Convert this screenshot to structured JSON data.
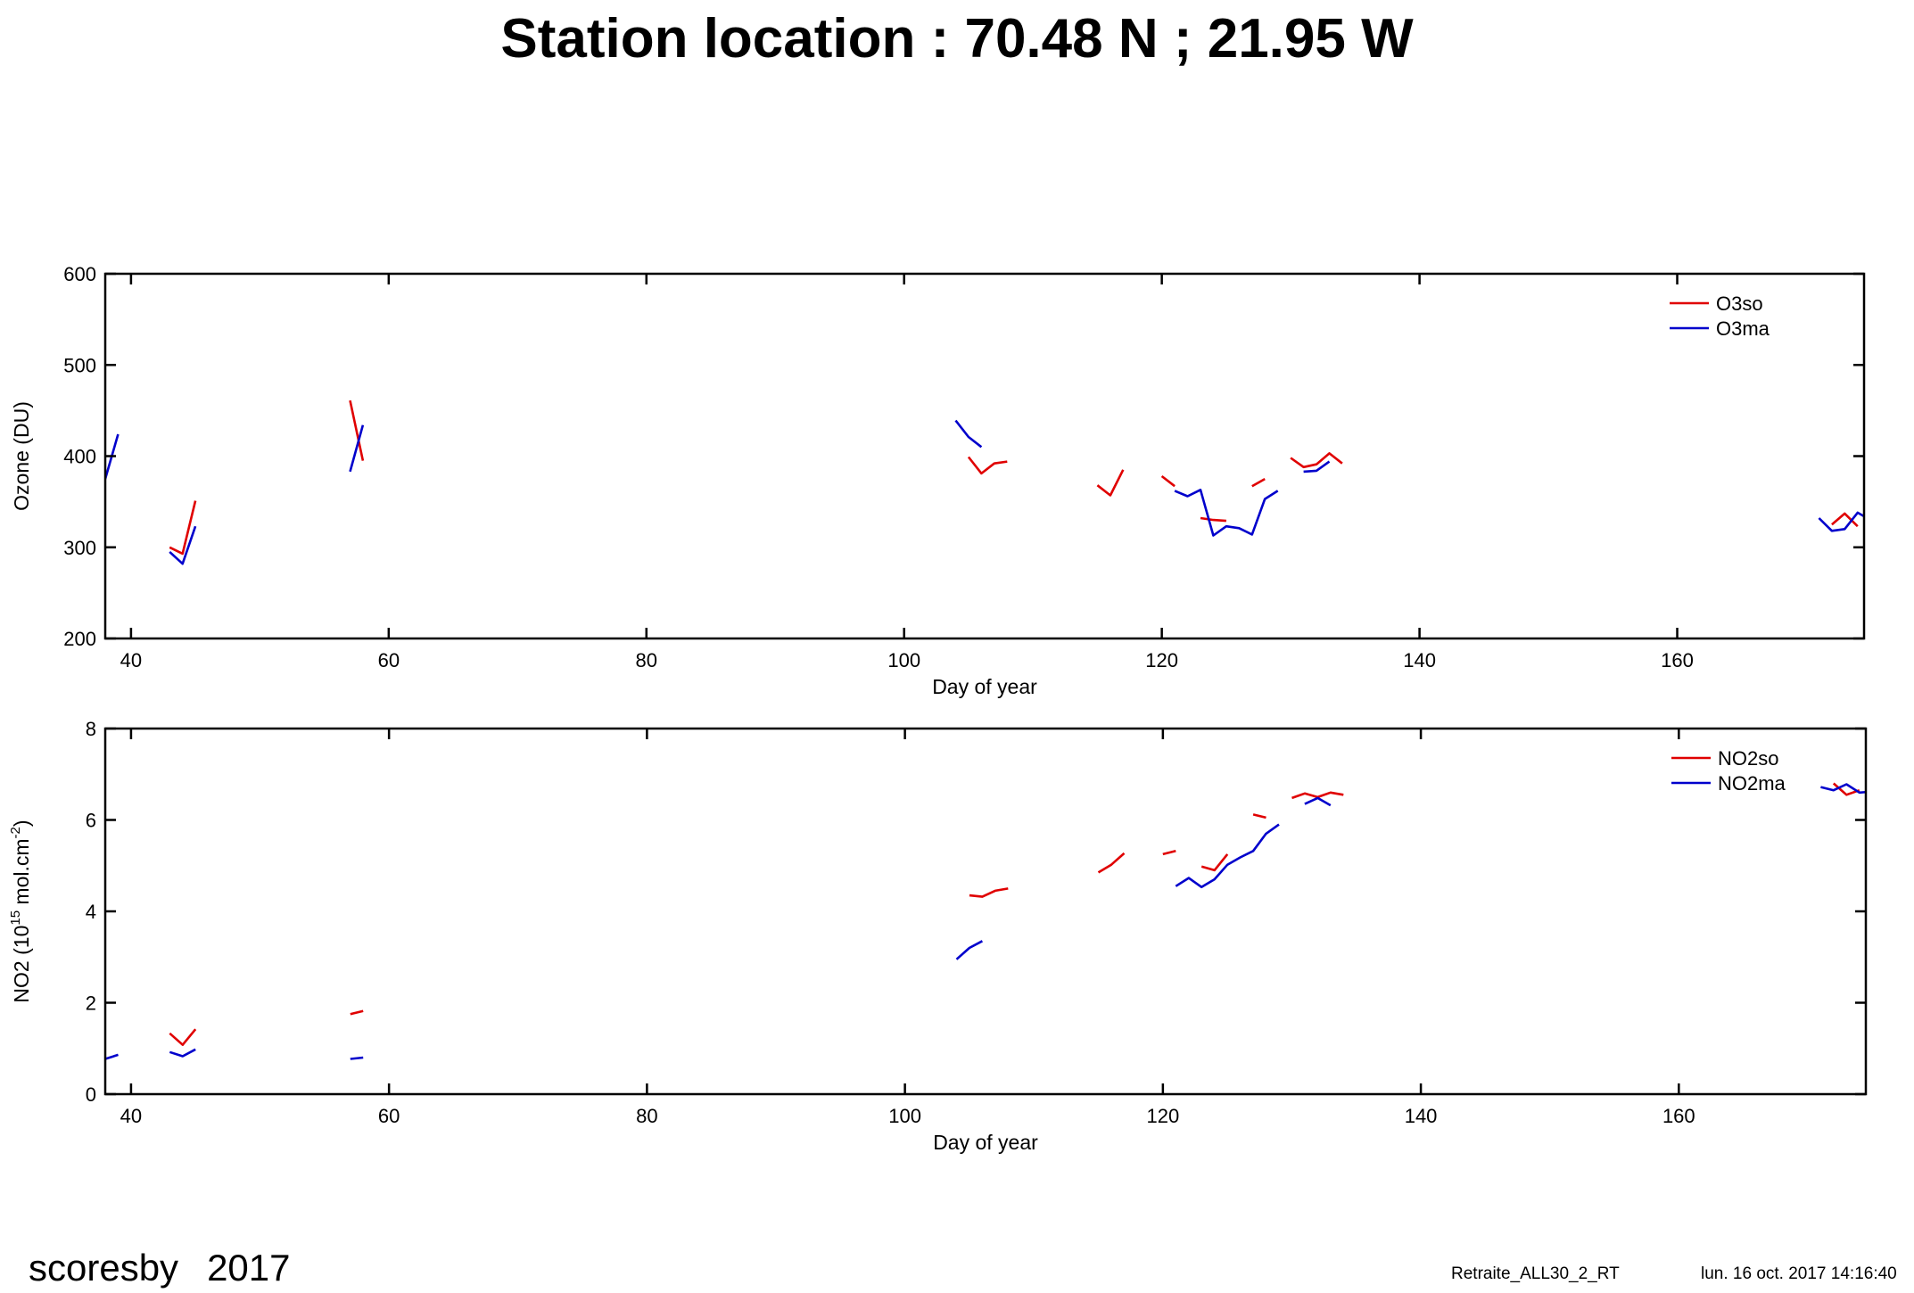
{
  "title": "Station location : 70.48 N ; 21.95 W",
  "footer": {
    "station": "scoresby",
    "year": "2017",
    "run": "Retraite_ALL30_2_RT",
    "timestamp": "lun. 16 oct. 2017 14:16:40"
  },
  "colors": {
    "so": "#e00000",
    "ma": "#0000cc"
  },
  "chart_data": [
    {
      "type": "line",
      "xlabel": "Day of year",
      "ylabel": "Ozone (DU)",
      "xlim": [
        38,
        174.5
      ],
      "ylim": [
        200,
        600
      ],
      "xticks": [
        40,
        60,
        80,
        100,
        120,
        140,
        160
      ],
      "yticks": [
        200,
        300,
        400,
        500,
        600
      ],
      "legend_position": "top-right",
      "grid": false,
      "series": [
        {
          "name": "O3so",
          "color": "#e00000",
          "segments": [
            [
              [
                43,
                300
              ],
              [
                44,
                293
              ],
              [
                45,
                351
              ]
            ],
            [
              [
                57,
                461
              ],
              [
                58,
                395
              ]
            ],
            [
              [
                105,
                399
              ],
              [
                106,
                381
              ],
              [
                107,
                392
              ],
              [
                108,
                394
              ]
            ],
            [
              [
                115,
                368
              ],
              [
                116,
                357
              ],
              [
                117,
                385
              ]
            ],
            [
              [
                120,
                378
              ],
              [
                121,
                367
              ]
            ],
            [
              [
                123,
                332
              ],
              [
                124,
                330
              ],
              [
                125,
                329
              ]
            ],
            [
              [
                127,
                367
              ],
              [
                128,
                375
              ]
            ],
            [
              [
                130,
                398
              ],
              [
                131,
                388
              ],
              [
                132,
                391
              ],
              [
                133,
                403
              ],
              [
                134,
                392
              ]
            ],
            [
              [
                172,
                325
              ],
              [
                173,
                337
              ],
              [
                174,
                323
              ]
            ]
          ]
        },
        {
          "name": "O3ma",
          "color": "#0000cc",
          "segments": [
            [
              [
                38,
                375
              ],
              [
                39,
                424
              ]
            ],
            [
              [
                43,
                295
              ],
              [
                44,
                282
              ],
              [
                45,
                323
              ]
            ],
            [
              [
                57,
                383
              ],
              [
                58,
                434
              ]
            ],
            [
              [
                104,
                439
              ],
              [
                105,
                421
              ],
              [
                106,
                410
              ]
            ],
            [
              [
                121,
                362
              ],
              [
                122,
                356
              ],
              [
                123,
                363
              ],
              [
                124,
                313
              ],
              [
                125,
                323
              ],
              [
                126,
                321
              ],
              [
                127,
                314
              ],
              [
                128,
                353
              ],
              [
                129,
                362
              ]
            ],
            [
              [
                131,
                383
              ],
              [
                132,
                384
              ],
              [
                133,
                394
              ]
            ],
            [
              [
                171,
                332
              ],
              [
                172,
                318
              ],
              [
                173,
                320
              ],
              [
                174,
                338
              ],
              [
                175,
                330
              ]
            ]
          ]
        }
      ]
    },
    {
      "type": "line",
      "xlabel": "Day of year",
      "ylabel": "NO2 (10^15 mol.cm^-2)",
      "xlim": [
        38,
        174.5
      ],
      "ylim": [
        0,
        8
      ],
      "xticks": [
        40,
        60,
        80,
        100,
        120,
        140,
        160
      ],
      "yticks": [
        0,
        2,
        4,
        6,
        8
      ],
      "legend_position": "top-right",
      "grid": false,
      "series": [
        {
          "name": "NO2so",
          "color": "#e00000",
          "segments": [
            [
              [
                43,
                1.33
              ],
              [
                44,
                1.08
              ],
              [
                45,
                1.42
              ]
            ],
            [
              [
                57,
                1.75
              ],
              [
                58,
                1.82
              ]
            ],
            [
              [
                105,
                4.35
              ],
              [
                106,
                4.32
              ],
              [
                107,
                4.45
              ],
              [
                108,
                4.5
              ]
            ],
            [
              [
                115,
                4.85
              ],
              [
                116,
                5.02
              ],
              [
                117,
                5.27
              ]
            ],
            [
              [
                120,
                5.25
              ],
              [
                121,
                5.32
              ]
            ],
            [
              [
                123,
                4.98
              ],
              [
                124,
                4.9
              ],
              [
                125,
                5.25
              ]
            ],
            [
              [
                127,
                6.12
              ],
              [
                128,
                6.05
              ]
            ],
            [
              [
                130,
                6.48
              ],
              [
                131,
                6.58
              ],
              [
                132,
                6.5
              ],
              [
                133,
                6.6
              ],
              [
                134,
                6.55
              ]
            ],
            [
              [
                172,
                6.8
              ],
              [
                173,
                6.55
              ],
              [
                174,
                6.65
              ]
            ]
          ]
        },
        {
          "name": "NO2ma",
          "color": "#0000cc",
          "segments": [
            [
              [
                38,
                0.77
              ],
              [
                39,
                0.86
              ]
            ],
            [
              [
                43,
                0.92
              ],
              [
                44,
                0.83
              ],
              [
                45,
                0.98
              ]
            ],
            [
              [
                57,
                0.77
              ],
              [
                58,
                0.8
              ]
            ],
            [
              [
                104,
                2.95
              ],
              [
                105,
                3.2
              ],
              [
                106,
                3.35
              ]
            ],
            [
              [
                121,
                4.55
              ],
              [
                122,
                4.73
              ],
              [
                123,
                4.53
              ],
              [
                124,
                4.7
              ],
              [
                125,
                5.02
              ],
              [
                126,
                5.18
              ],
              [
                127,
                5.32
              ],
              [
                128,
                5.7
              ],
              [
                129,
                5.9
              ]
            ],
            [
              [
                131,
                6.35
              ],
              [
                132,
                6.48
              ],
              [
                133,
                6.32
              ]
            ],
            [
              [
                171,
                6.72
              ],
              [
                172,
                6.65
              ],
              [
                173,
                6.78
              ],
              [
                174,
                6.6
              ],
              [
                175,
                6.62
              ]
            ]
          ]
        }
      ]
    }
  ]
}
